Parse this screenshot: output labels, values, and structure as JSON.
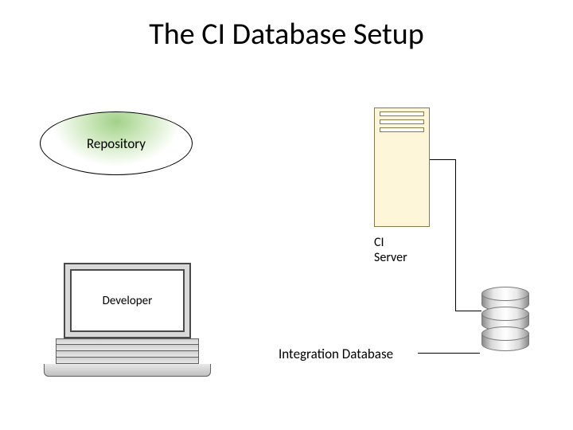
{
  "title": "The CI Database Setup",
  "nodes": {
    "repository": "Repository",
    "developer": "Developer",
    "ci_server": "CI\nServer",
    "integration_db": "Integration Database"
  }
}
